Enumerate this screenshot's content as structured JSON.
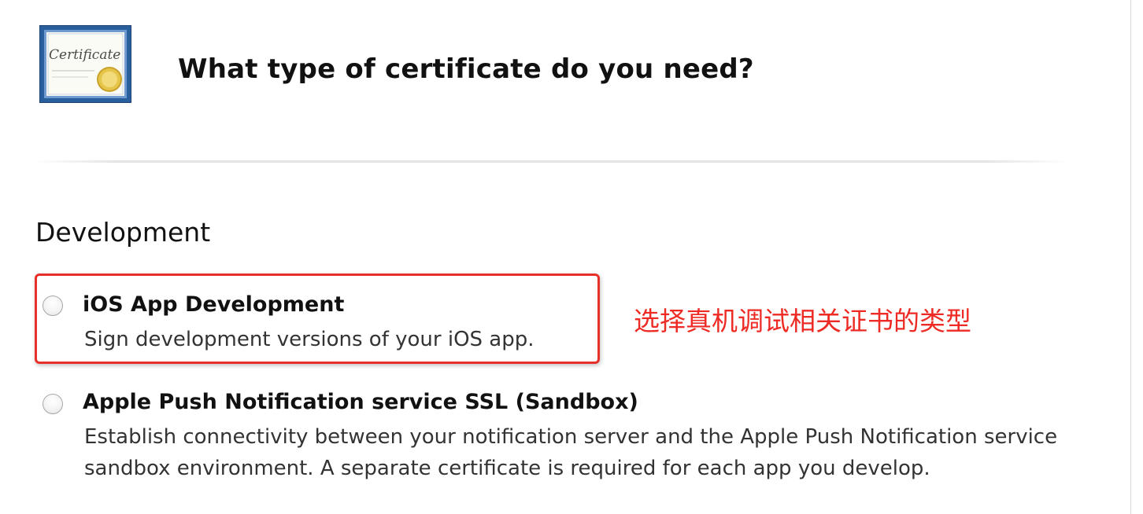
{
  "header": {
    "title": "What type of certificate do you need?",
    "icon_label": "Certificate"
  },
  "section": {
    "heading": "Development"
  },
  "options": [
    {
      "title": "iOS App Development",
      "description": "Sign development versions of your iOS app.",
      "selected": false
    },
    {
      "title": "Apple Push Notification service SSL (Sandbox)",
      "description": "Establish connectivity between your notification server and the Apple Push Notification service sandbox environment. A separate certificate is required for each app you develop.",
      "selected": false
    }
  ],
  "annotation": {
    "text": "选择真机调试相关证书的类型",
    "color": "#ee2a24"
  },
  "colors": {
    "highlight_border": "#e8302a",
    "certificate_frame": "#2a5f9e",
    "seal": "#e6c64a"
  }
}
